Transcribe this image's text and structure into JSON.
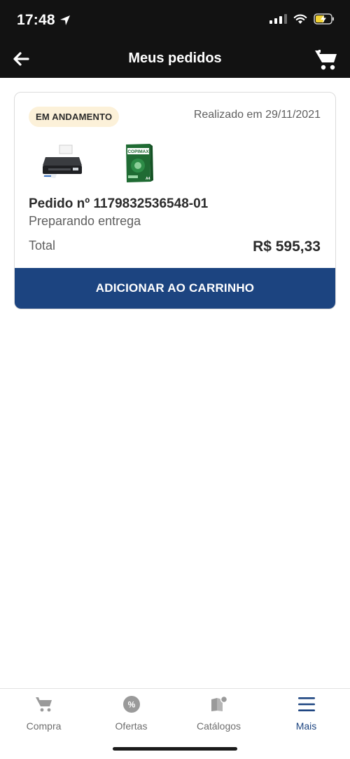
{
  "status_bar": {
    "time": "17:48"
  },
  "header": {
    "title": "Meus pedidos"
  },
  "order": {
    "status": "EM ANDAMENTO",
    "date": "Realizado em 29/11/2021",
    "number": "Pedido nº 1179832536548-01",
    "delivery_status": "Preparando entrega",
    "total_label": "Total",
    "total_value": "R$ 595,33",
    "products": [
      {
        "icon": "printer-image"
      },
      {
        "icon": "paper-ream-image",
        "brand": "COPIMAX"
      }
    ],
    "action_label": "ADICIONAR AO CARRINHO"
  },
  "tabs": [
    {
      "label": "Compra",
      "icon": "cart-icon",
      "active": false
    },
    {
      "label": "Ofertas",
      "icon": "percent-badge-icon",
      "active": false
    },
    {
      "label": "Catálogos",
      "icon": "catalog-icon",
      "active": false
    },
    {
      "label": "Mais",
      "icon": "menu-icon",
      "active": true
    }
  ],
  "colors": {
    "primary": "#1c4480",
    "badge_bg": "#fcf1d9",
    "header_bg": "#121212"
  }
}
